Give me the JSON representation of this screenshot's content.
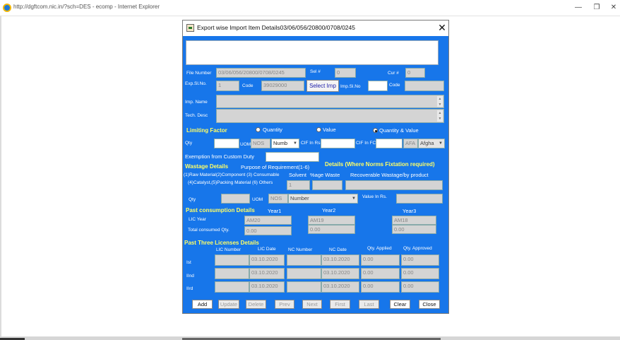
{
  "window": {
    "title": "http://dgftcom.nic.in/?sch=DES - ecomp - Internet Explorer",
    "min_label": "—",
    "restore_label": "❐",
    "close_label": "✕"
  },
  "dialog": {
    "title": "Export wise Import Item Details03/06/056/20800/0708/0245",
    "close_label": "✕",
    "message": ""
  },
  "form": {
    "file_number_label": "File Number",
    "file_number_value": "03/06/056/20800/0708/0245",
    "sel_label": "Sel  #",
    "sel_value": "0",
    "cur_label": "Cur  #",
    "cur_value": "0",
    "exp_sl_label": "Exp.Sl.No.",
    "exp_sl_value": "1",
    "code_label": "Code",
    "code_value": "39029000",
    "select_imp_label": "Select Imp",
    "imp_sl_label": "Imp.Sl.No",
    "imp_sl_value": "",
    "code2_label": "Code",
    "code2_value": "",
    "imp_name_label": "Imp. Name",
    "tech_desc_label": "Tech. Desc",
    "limiting_factor_label": "Limiting Factor",
    "radio_quantity": "Quantity",
    "radio_value": "Value",
    "radio_qty_value": "Quantity & Value",
    "qty_label": "Qty",
    "uom_label": "UOM",
    "uom_value": "NOS",
    "numb_select": "Numb",
    "cif_rs_label": "CIF In Rs",
    "cif_fc_label": "CIF In FC",
    "afa_label": "AFA",
    "afgha_select": "Afgha",
    "exemption_label": "Exemption  from  Custom Duty"
  },
  "wastage": {
    "heading": "Wastage Details",
    "purpose_label": "Purpose of Requirement(1-6)",
    "details_heading": "Details (Where Norms Fixtation required)",
    "raw_material_label": "(1)Raw Material(2)Component (3) Consumable",
    "solvent_label": "Solvent",
    "age_waste_label": "%age Waste",
    "recoverable_label": "Recoverable Wastage/by product",
    "catalyst_label": "(4)Catalyst,(5)Packing Material (6) Others",
    "purpose_value": "1",
    "qty_label": "Qty",
    "uom_label": "UOM",
    "uom_value": "NOS",
    "uom_select": "Number",
    "value_rs_label": "Value In Rs."
  },
  "past": {
    "heading": "Past consumption Details",
    "year1": "Year1",
    "year2": "Year2",
    "year3": "Year3",
    "lic_year_label": "LIC Year",
    "total_label": "Total consumed Qty.",
    "y1_lic": "AM20",
    "y2_lic": "AM19",
    "y3_lic": "AM18",
    "y1_total": "0.00",
    "y2_total": "0.00",
    "y3_total": "0.00"
  },
  "licenses": {
    "heading": "Past Three  Licenses Details",
    "headers": [
      "LIC Number",
      "LIC Date",
      "NC Number",
      "NC Date",
      "Qty. Applied",
      "Qty. Approved"
    ],
    "rows": [
      {
        "label": "Ist",
        "lic_number": "",
        "lic_date": "03.10.2020",
        "nc_number": "",
        "nc_date": "03.10.2020",
        "qty_applied": "0.00",
        "qty_approved": "0.00"
      },
      {
        "label": "IInd",
        "lic_number": "",
        "lic_date": "03.10.2020",
        "nc_number": "",
        "nc_date": "03.10.2020",
        "qty_applied": "0.00",
        "qty_approved": "0.00"
      },
      {
        "label": "IIrd",
        "lic_number": "",
        "lic_date": "03.10.2020",
        "nc_number": "",
        "nc_date": "03.10.2020",
        "qty_applied": "0.00",
        "qty_approved": "0.00"
      }
    ]
  },
  "buttons": {
    "add": "Add",
    "update": "Update",
    "delete": "Delete",
    "prev": "Prev",
    "next": "Next",
    "first": "First",
    "last": "Last",
    "clear": "Clear",
    "close": "Close"
  },
  "colors": {
    "dialog_bg": "#1776ea",
    "heading_yellow": "#ffff66"
  }
}
